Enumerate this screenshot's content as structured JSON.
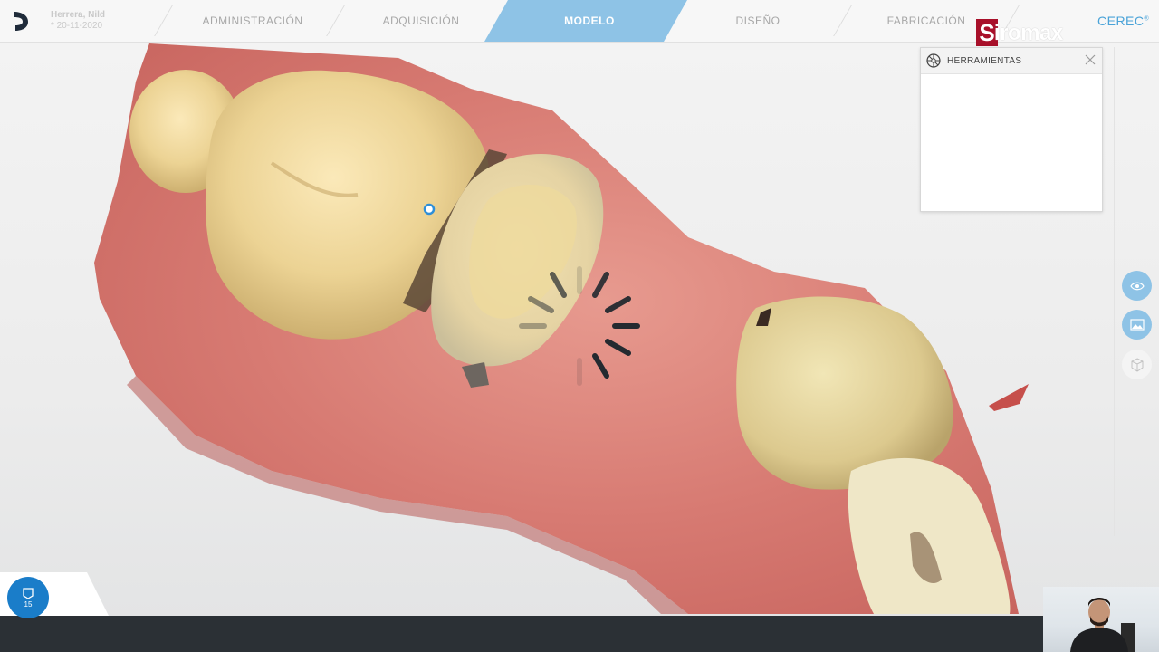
{
  "header": {
    "patient_name": "Herrera, Nild",
    "patient_date": "* 20-11-2020",
    "brand": "CEREC",
    "brand_mark": "®",
    "steps": [
      {
        "label": "ADMINISTRACIÓN",
        "active": false
      },
      {
        "label": "ADQUISICIÓN",
        "active": false
      },
      {
        "label": "MODELO",
        "active": true
      },
      {
        "label": "DISEÑO",
        "active": false
      },
      {
        "label": "FABRICACIÓN",
        "active": false
      }
    ]
  },
  "watermark": {
    "initial": "S",
    "text": "iromax"
  },
  "tools_panel": {
    "title": "HERRAMIENTAS"
  },
  "side_rail": {
    "buttons": [
      "eye-icon",
      "image-icon",
      "cube-icon"
    ]
  },
  "bottom": {
    "scan_count": "15"
  },
  "colors": {
    "accent": "#8ec3e6",
    "brand": "#4aa3d8",
    "scan_button": "#1a7dc9",
    "bottom_bar": "#2b3035"
  }
}
